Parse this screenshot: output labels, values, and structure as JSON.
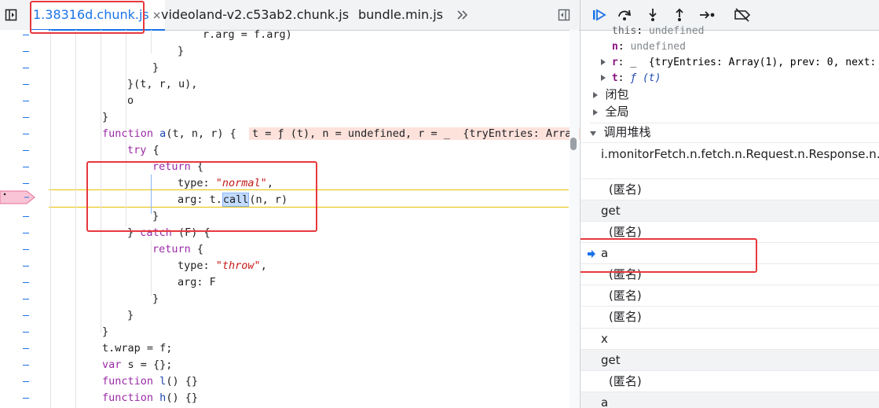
{
  "tabs": [
    {
      "label": "1.38316d.chunk.js",
      "close": "×",
      "active": true
    },
    {
      "label": "videoland-v2.c53ab2.chunk.js",
      "active": false
    },
    {
      "label": "bundle.min.js",
      "active": false
    }
  ],
  "icons": {
    "sidebar_toggle": "panel-toggle-icon",
    "more_tabs": "chevron-double-right-icon",
    "format": "format-panel-icon"
  },
  "code": {
    "l1": "r.arg = f.arg)",
    "l2": "}",
    "l3": "}",
    "l4": "}(t, r, u),",
    "l5": "o",
    "l6": "}",
    "l7_kw": "function",
    "l7_fn": "a",
    "l7_rest": "(t, n, r) {",
    "l7_inline": "t = ƒ (t), n = undefined, r = _  {tryEntries: Array",
    "l8_kw": "try",
    "l8_rest": " {",
    "l9_kw": "return",
    "l9_rest": " {",
    "l10_a": "type: ",
    "l10_str": "\"normal\"",
    "l10_b": ",",
    "l11_a": "arg: t.",
    "l11_hl": "call",
    "l11_b": "(n, r)",
    "l12": "}",
    "l13_a": "} ",
    "l13_kw": "catch",
    "l13_b": " (F) {",
    "l14_kw": "return",
    "l14_rest": " {",
    "l15_a": "type: ",
    "l15_str": "\"throw\"",
    "l15_b": ",",
    "l16": "arg: F",
    "l17": "}",
    "l18": "}",
    "l19": "}",
    "l20": "t.wrap = f;",
    "l21_kw": "var",
    "l21_rest": " s = {};",
    "l22_kw": "function",
    "l22_fn": "l",
    "l22_rest": "() {}",
    "l23_kw": "function",
    "l23_fn": "h",
    "l23_rest": "() {}"
  },
  "scope": {
    "this_name": "this",
    "this_val": "undefined",
    "n_name": "n",
    "n_val": "undefined",
    "r_name": "r",
    "r_val": "_  {tryEntries: Array(1), prev: 0, next:",
    "t_name": "t",
    "t_val": "ƒ (t)",
    "closure": "闭包",
    "global": "全局",
    "callstack": "调用堆栈"
  },
  "callstack": [
    {
      "label": "i.monitorFetch.n.fetch.n.Request.n.Response.n.Pro"
    },
    {
      "label": "(匿名)"
    },
    {
      "label": "get"
    },
    {
      "label": "(匿名)"
    },
    {
      "label": "a",
      "current": true
    },
    {
      "label": "(匿名)"
    },
    {
      "label": "(匿名)"
    },
    {
      "label": "(匿名)"
    },
    {
      "label": "x"
    },
    {
      "label": "get"
    },
    {
      "label": "(匿名)"
    },
    {
      "label": "a"
    }
  ],
  "colors": {
    "accent": "#1a73e8",
    "highlight_box": "#e8383d",
    "current_line": "#e6c200"
  }
}
